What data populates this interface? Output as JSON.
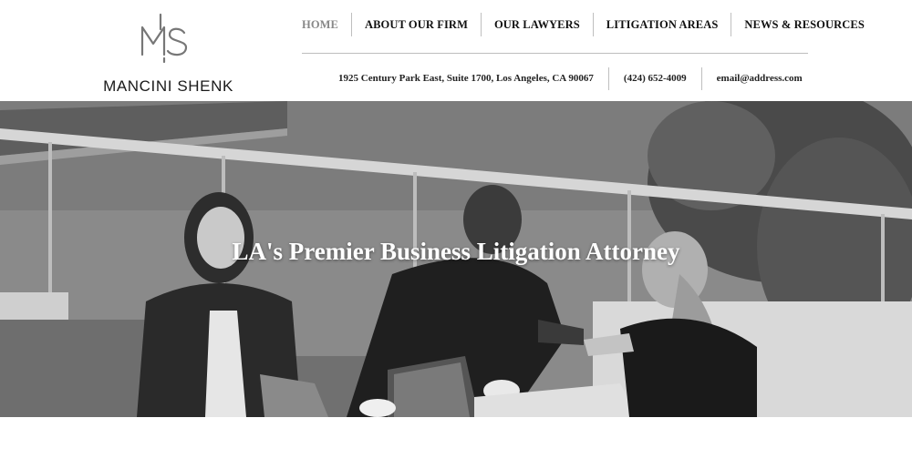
{
  "brand": {
    "monogram": "MS",
    "name": "MANCINI SHENK"
  },
  "nav": {
    "items": [
      {
        "label": "HOME",
        "active": true
      },
      {
        "label": "ABOUT OUR FIRM",
        "active": false
      },
      {
        "label": "OUR LAWYERS",
        "active": false
      },
      {
        "label": "LITIGATION AREAS",
        "active": false
      },
      {
        "label": "NEWS & RESOURCES",
        "active": false
      }
    ]
  },
  "contact": {
    "address": "1925 Century Park East, Suite 1700, Los Angeles, CA 90067",
    "phone": "(424) 652-4009",
    "email": "email@address.com"
  },
  "hero": {
    "title": "LA's Premier Business Litigation Attorney",
    "image_description_icon": "business-handshake-photo"
  },
  "colors": {
    "text": "#111111",
    "nav_active": "#888888",
    "divider": "#bdbdbd",
    "hero_title": "#ffffff"
  }
}
